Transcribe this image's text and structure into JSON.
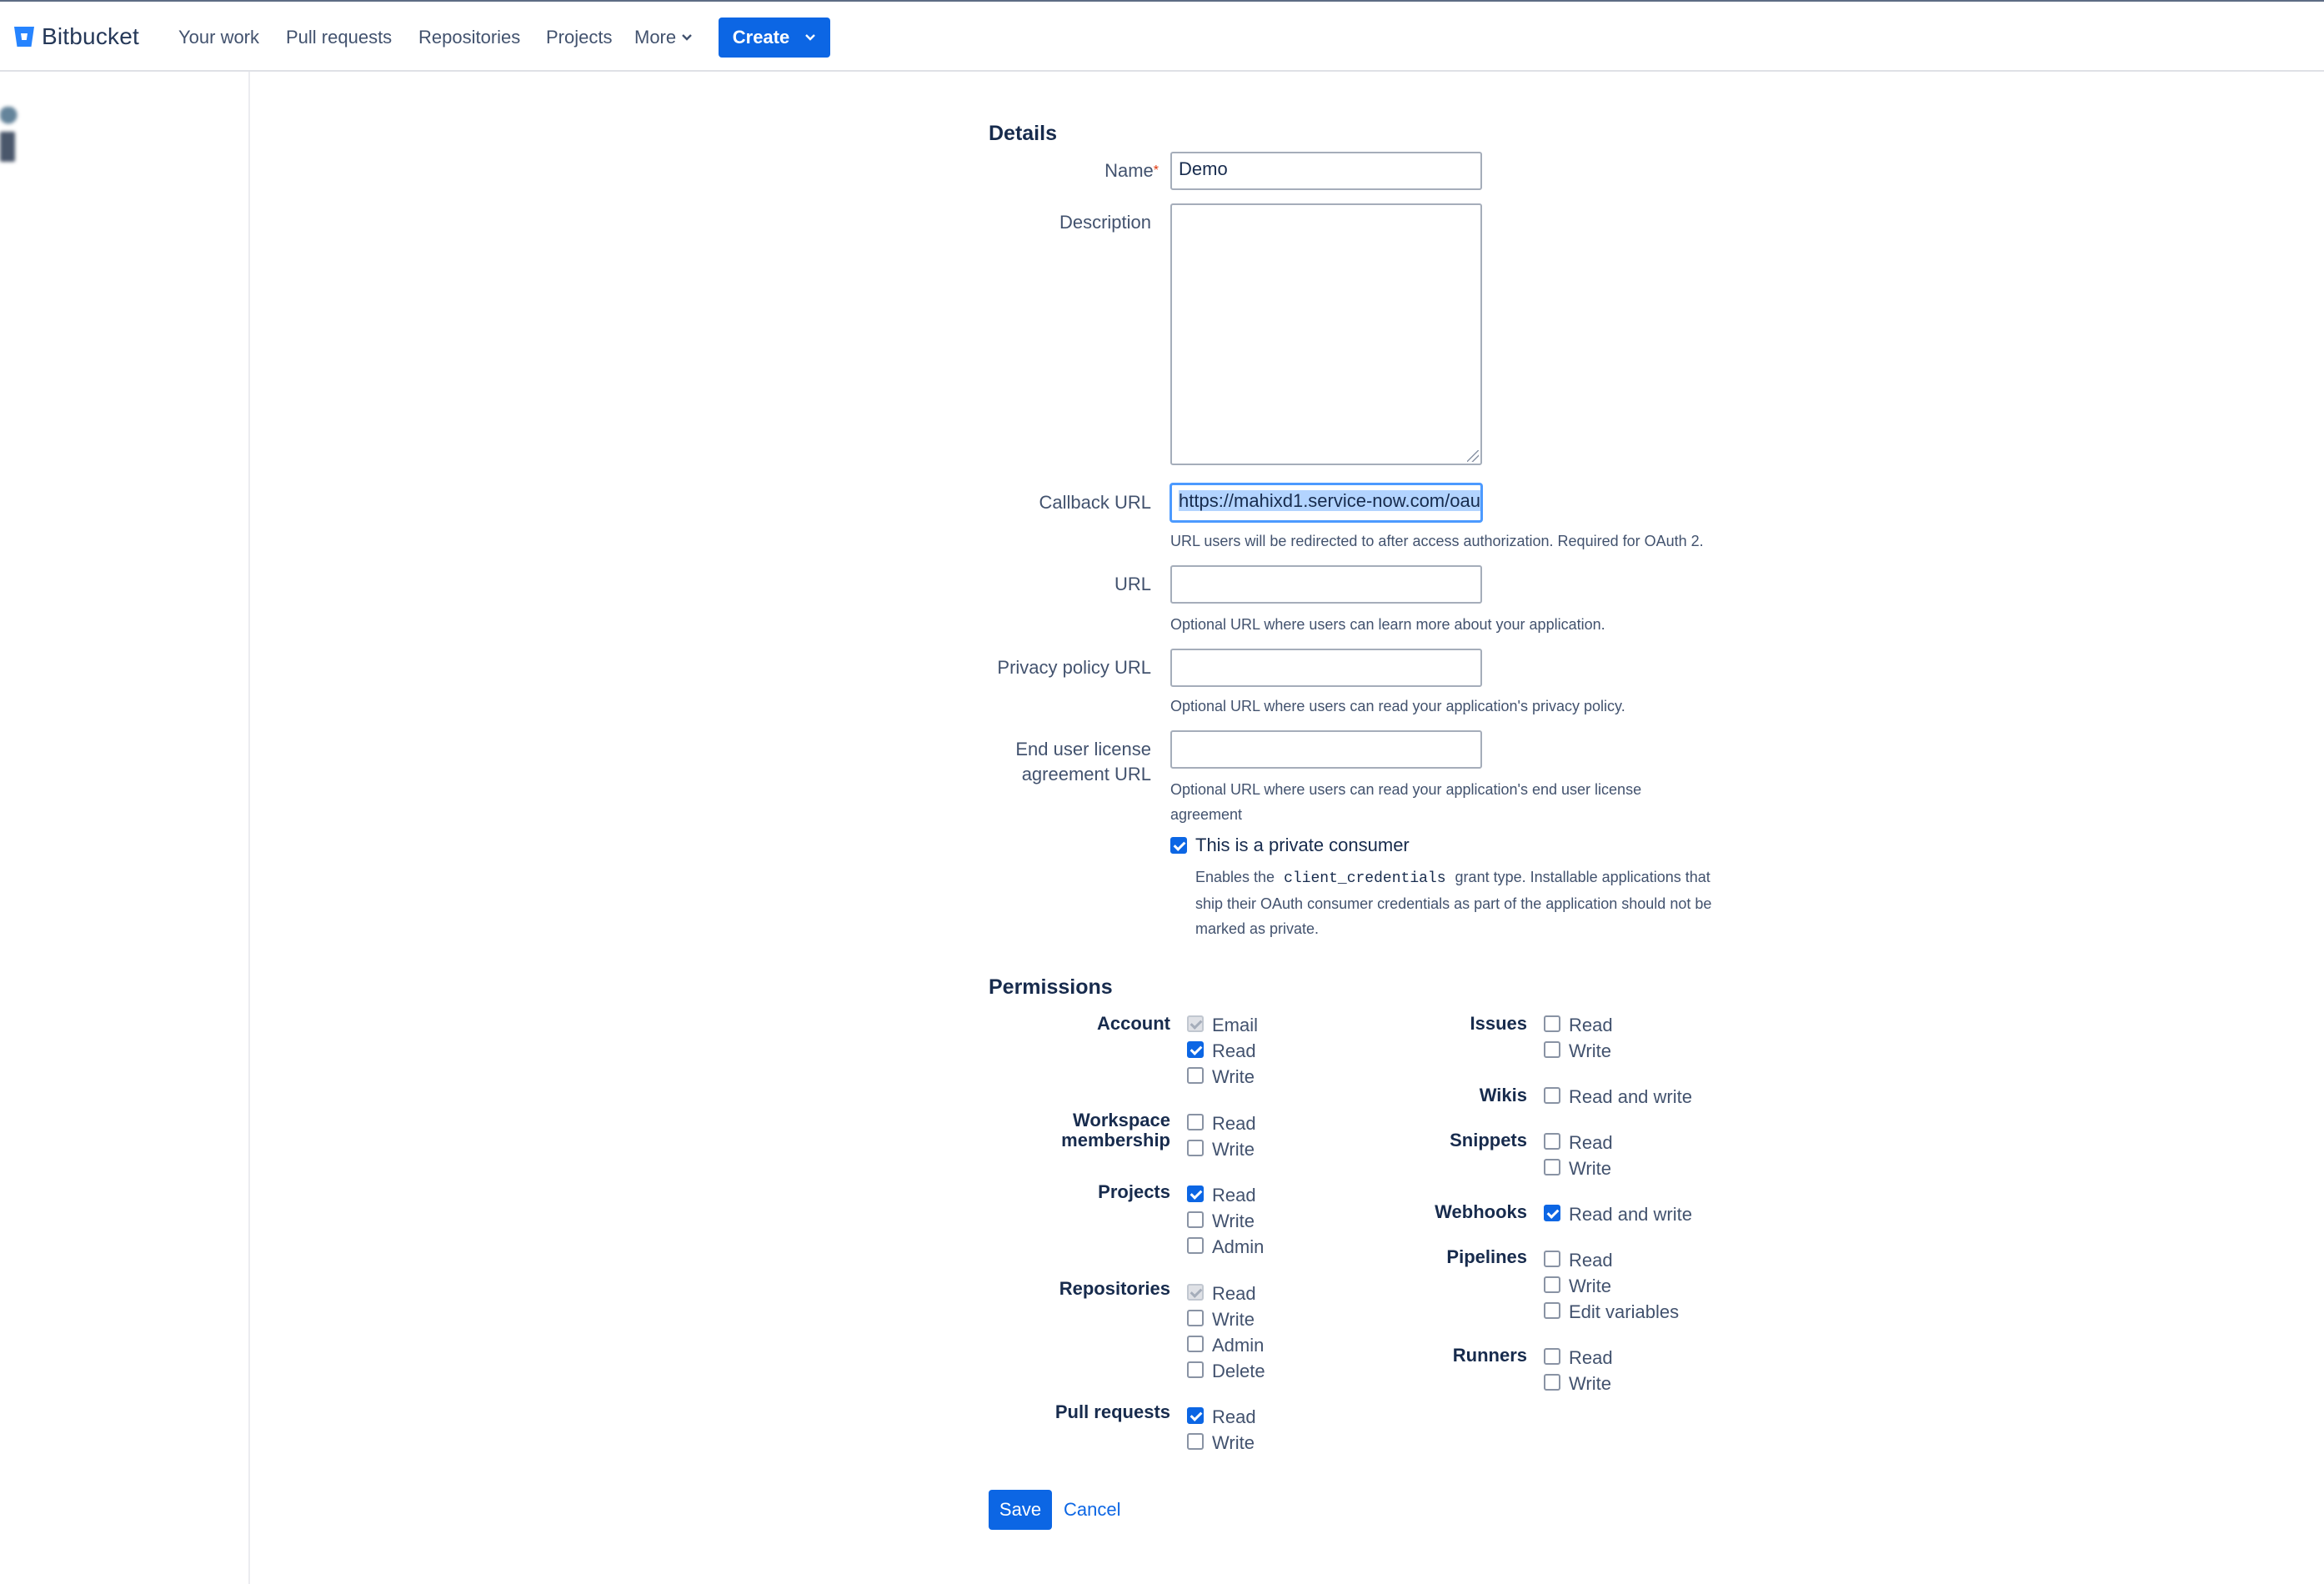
{
  "header": {
    "brand": "Bitbucket",
    "nav": [
      "Your work",
      "Pull requests",
      "Repositories",
      "Projects"
    ],
    "more_label": "More",
    "create_label": "Create",
    "accent": "#0c66e4"
  },
  "details": {
    "title": "Details",
    "name_label": "Name",
    "name_required_mark": "*",
    "name_value": "Demo",
    "description_label": "Description",
    "description_value": "",
    "callback_label": "Callback URL",
    "callback_value": "https://mahixd1.service-now.com/oau",
    "callback_help": "URL users will be redirected to after access authorization. Required for OAuth 2.",
    "url_label": "URL",
    "url_value": "",
    "url_help": "Optional URL where users can learn more about your application.",
    "privacy_label": "Privacy policy URL",
    "privacy_value": "",
    "privacy_help": "Optional URL where users can read your application's privacy policy.",
    "eula_label_line1": "End user license",
    "eula_label_line2": "agreement URL",
    "eula_value": "",
    "eula_help": "Optional URL where users can read your application's end user license agreement",
    "private_label": "This is a private consumer",
    "private_checked": true,
    "private_help_pre": "Enables the",
    "private_help_code": "client_credentials",
    "private_help_post": "grant type. Installable applications that ship their OAuth consumer credentials as part of the application should not be marked as private."
  },
  "permissions": {
    "title": "Permissions",
    "account": {
      "label": "Account",
      "options": [
        "Email",
        "Read",
        "Write"
      ],
      "checked": [
        true,
        true,
        false
      ],
      "disabled": [
        true,
        false,
        false
      ]
    },
    "workspace": {
      "label_line1": "Workspace",
      "label_line2": "membership",
      "options": [
        "Read",
        "Write"
      ],
      "checked": [
        false,
        false
      ]
    },
    "projects": {
      "label": "Projects",
      "options": [
        "Read",
        "Write",
        "Admin"
      ],
      "checked": [
        true,
        false,
        false
      ]
    },
    "repositories": {
      "label": "Repositories",
      "options": [
        "Read",
        "Write",
        "Admin",
        "Delete"
      ],
      "checked": [
        true,
        false,
        false,
        false
      ],
      "disabled": [
        true,
        false,
        false,
        false
      ]
    },
    "pull_requests": {
      "label": "Pull requests",
      "options": [
        "Read",
        "Write"
      ],
      "checked": [
        true,
        false
      ]
    },
    "issues": {
      "label": "Issues",
      "options": [
        "Read",
        "Write"
      ],
      "checked": [
        false,
        false
      ]
    },
    "wikis": {
      "label": "Wikis",
      "options": [
        "Read and write"
      ],
      "checked": [
        false
      ]
    },
    "snippets": {
      "label": "Snippets",
      "options": [
        "Read",
        "Write"
      ],
      "checked": [
        false,
        false
      ]
    },
    "webhooks": {
      "label": "Webhooks",
      "options": [
        "Read and write"
      ],
      "checked": [
        true
      ]
    },
    "pipelines": {
      "label": "Pipelines",
      "options": [
        "Read",
        "Write",
        "Edit variables"
      ],
      "checked": [
        false,
        false,
        false
      ]
    },
    "runners": {
      "label": "Runners",
      "options": [
        "Read",
        "Write"
      ],
      "checked": [
        false,
        false
      ]
    }
  },
  "actions": {
    "save_label": "Save",
    "cancel_label": "Cancel"
  }
}
